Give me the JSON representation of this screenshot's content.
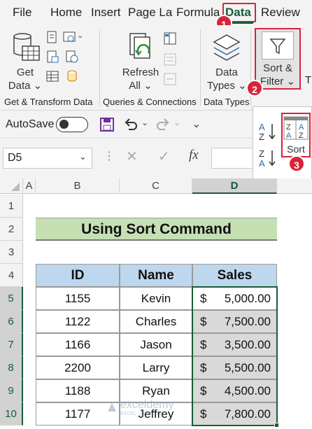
{
  "tabs": [
    "File",
    "Home",
    "Insert",
    "Page Lay",
    "Formula",
    "Data",
    "Review"
  ],
  "active_tab": "Data",
  "ribbon": {
    "get_data": {
      "line1": "Get",
      "line2": "Data ⌄"
    },
    "refresh_all": {
      "line1": "Refresh",
      "line2": "All ⌄"
    },
    "data_types": {
      "line1": "Data",
      "line2": "Types ⌄"
    },
    "sort_filter": {
      "line1": "Sort &",
      "line2": "Filter ⌄"
    },
    "groups": {
      "get_transform": "Get & Transform Data",
      "queries": "Queries & Connections",
      "data_types": "Data Types"
    },
    "overflow_letter": "T"
  },
  "qat": {
    "autosave_label": "AutoSave",
    "autosave_state": "Off"
  },
  "formula_bar": {
    "name_box": "D5",
    "fx": "fx",
    "formula": ""
  },
  "sort_menu": {
    "az": "A↓Z",
    "za": "Z↓A",
    "sort_label": "Sort"
  },
  "badges": {
    "one": "1",
    "two": "2",
    "three": "3"
  },
  "columns": [
    "A",
    "B",
    "C",
    "D"
  ],
  "rows": [
    "1",
    "2",
    "3",
    "4",
    "5",
    "6",
    "7",
    "8",
    "9",
    "10"
  ],
  "sheet": {
    "title": "Using Sort Command",
    "headers": {
      "id": "ID",
      "name": "Name",
      "sales": "Sales"
    },
    "records": [
      {
        "id": "1155",
        "name": "Kevin",
        "currency": "$",
        "sales": "5,000.00"
      },
      {
        "id": "1122",
        "name": "Charles",
        "currency": "$",
        "sales": "7,500.00"
      },
      {
        "id": "1166",
        "name": "Jason",
        "currency": "$",
        "sales": "3,500.00"
      },
      {
        "id": "2200",
        "name": "Larry",
        "currency": "$",
        "sales": "5,500.00"
      },
      {
        "id": "1188",
        "name": "Ryan",
        "currency": "$",
        "sales": "4,500.00"
      },
      {
        "id": "1177",
        "name": "Jeffrey",
        "currency": "$",
        "sales": "7,800.00"
      }
    ]
  },
  "watermark": {
    "brand": "exceldemy",
    "tagline": "EXCEL · DATA · BI"
  },
  "colors": {
    "accent": "#185c37",
    "highlight": "#d6243b",
    "header_fill": "#bdd7ee",
    "title_fill": "#c6e0b4",
    "selection_fill": "#d9d9d9"
  }
}
